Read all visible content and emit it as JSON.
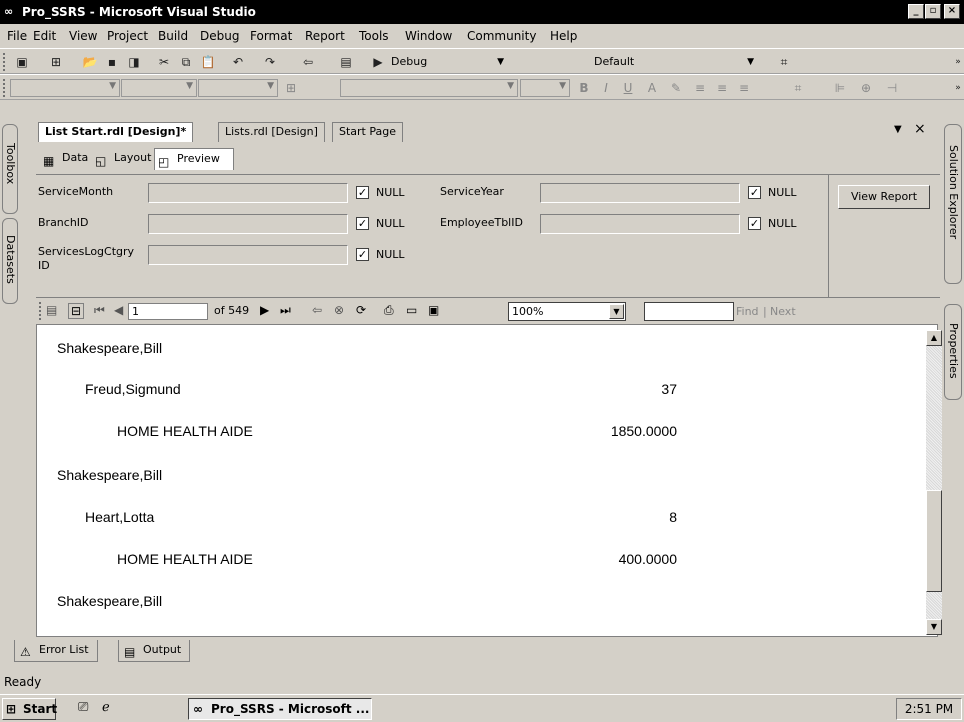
{
  "window": {
    "title": "Pro_SSRS - Microsoft Visual Studio"
  },
  "menu": [
    "File",
    "Edit",
    "View",
    "Project",
    "Build",
    "Debug",
    "Format",
    "Report",
    "Tools",
    "Window",
    "Community",
    "Help"
  ],
  "toolbar1": {
    "config": "Debug",
    "platform": "Default"
  },
  "side_left": {
    "toolbox": "Toolbox",
    "datasets": "Datasets"
  },
  "side_right": {
    "solution_explorer": "Solution Explorer",
    "properties": "Properties"
  },
  "doc_tabs": [
    "List Start.rdl [Design]*",
    "Lists.rdl [Design]",
    "Start Page"
  ],
  "sub_tabs": [
    "Data",
    "Layout",
    "Preview"
  ],
  "params": {
    "service_month": "ServiceMonth",
    "service_year": "ServiceYear",
    "branch_id": "BranchID",
    "employee_id": "EmployeeTblID",
    "services_log_line1": "ServicesLogCtgry",
    "services_log_line2": "ID",
    "null_label": "NULL",
    "view_report": "View Report"
  },
  "report_toolbar": {
    "page": "1",
    "of_pages": "of 549",
    "zoom": "100%",
    "find": "Find",
    "next": "Next",
    "sep": "|"
  },
  "report_rows": [
    {
      "name": "Shakespeare,Bill",
      "value": ""
    },
    {
      "name": "Freud,Sigmund",
      "value": "37"
    },
    {
      "name": "HOME HEALTH AIDE",
      "value": "1850.0000"
    },
    {
      "name": "Shakespeare,Bill",
      "value": ""
    },
    {
      "name": "Heart,Lotta",
      "value": "8"
    },
    {
      "name": "HOME HEALTH AIDE",
      "value": "400.0000"
    },
    {
      "name": "Shakespeare,Bill",
      "value": ""
    }
  ],
  "bottom_tabs": [
    "Error List",
    "Output"
  ],
  "status": "Ready",
  "taskbar": {
    "start": "Start",
    "item": "Pro_SSRS - Microsoft ...",
    "clock": "2:51 PM"
  }
}
